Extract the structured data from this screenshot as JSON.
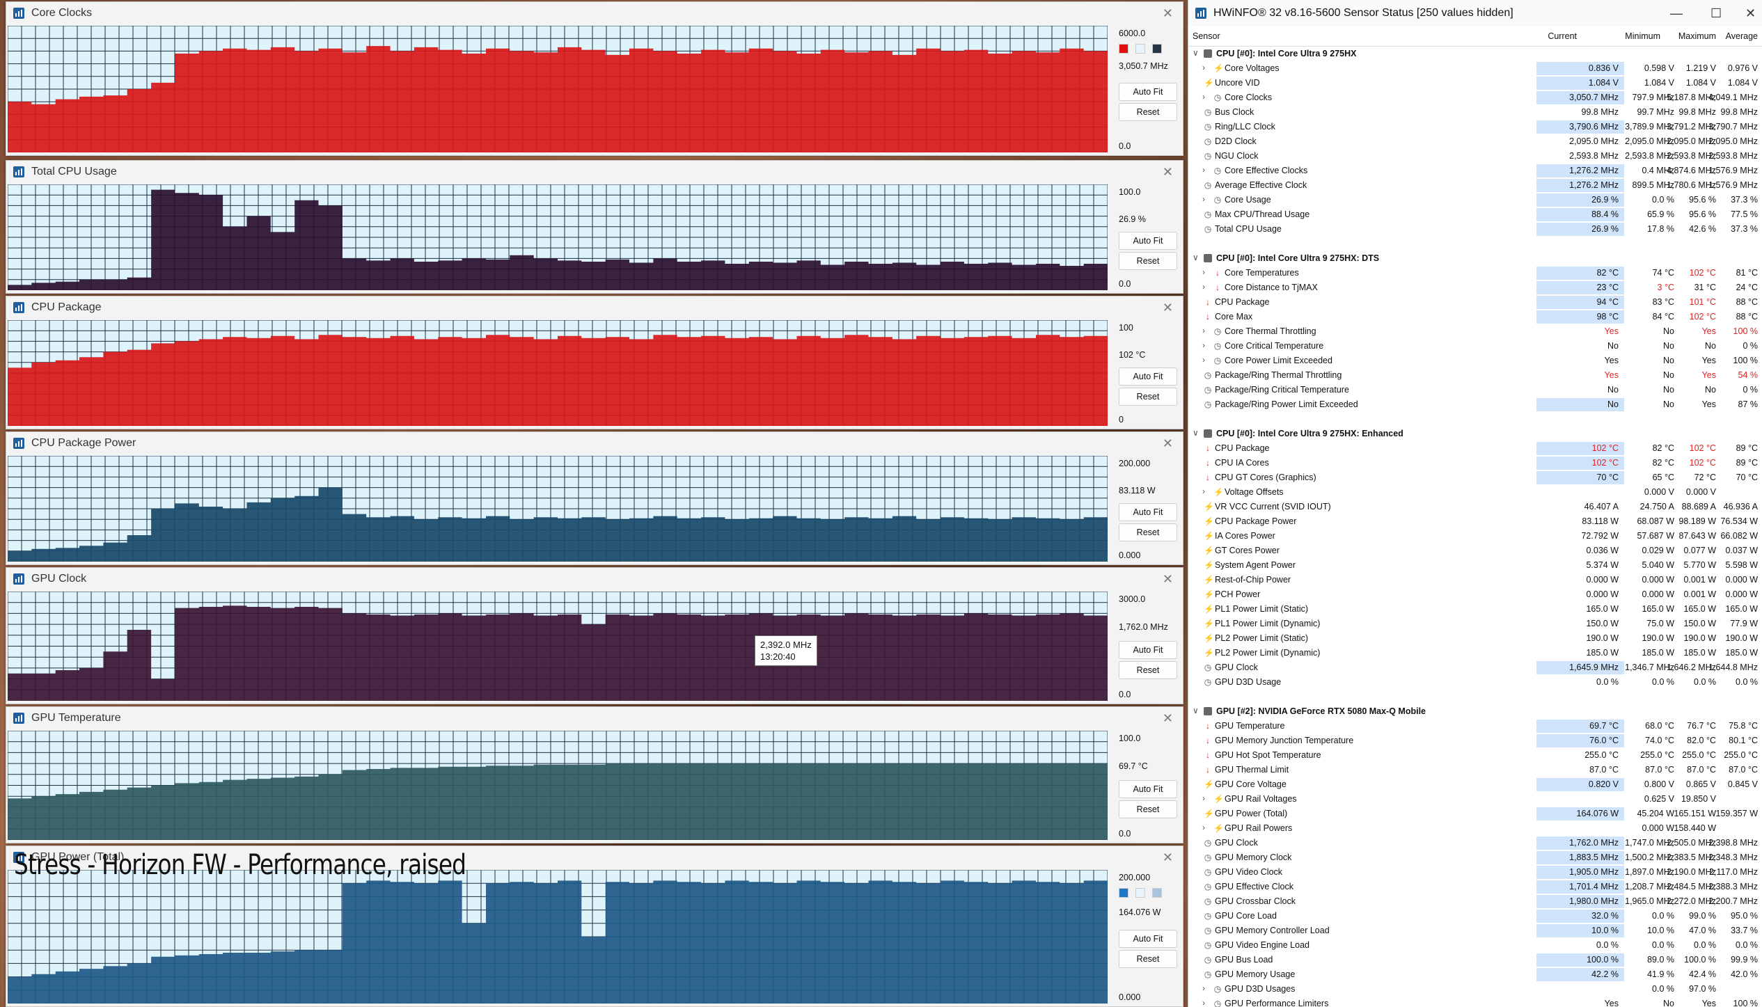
{
  "graphs": [
    {
      "title": "Core Clocks",
      "max": "6000.0",
      "current": "3,050.7 MHz",
      "min": "0.0",
      "auto_fit": "Auto Fit",
      "reset": "Reset",
      "color": "#d81818",
      "swatches": [
        "#e01010",
        "#e8f4fb",
        "#263444"
      ],
      "series": [
        0.4,
        0.38,
        0.42,
        0.44,
        0.45,
        0.5,
        0.55,
        0.78,
        0.8,
        0.82,
        0.81,
        0.83,
        0.8,
        0.82,
        0.79,
        0.84,
        0.8,
        0.83,
        0.81,
        0.78,
        0.82,
        0.8,
        0.79,
        0.83,
        0.81,
        0.77,
        0.82,
        0.8,
        0.78,
        0.81,
        0.79,
        0.82,
        0.8,
        0.78,
        0.81,
        0.79,
        0.8,
        0.77,
        0.82,
        0.8,
        0.81,
        0.78,
        0.8,
        0.79,
        0.82,
        0.8,
        0.78
      ]
    },
    {
      "title": "Total CPU Usage",
      "max": "100.0",
      "current": "26.9 %",
      "min": "0.0",
      "auto_fit": "Auto Fit",
      "reset": "Reset",
      "color": "#2a0f30",
      "series": [
        0.05,
        0.07,
        0.08,
        0.1,
        0.1,
        0.12,
        0.95,
        0.92,
        0.9,
        0.6,
        0.7,
        0.55,
        0.85,
        0.8,
        0.3,
        0.28,
        0.3,
        0.27,
        0.28,
        0.3,
        0.29,
        0.33,
        0.3,
        0.28,
        0.27,
        0.29,
        0.26,
        0.3,
        0.27,
        0.28,
        0.25,
        0.27,
        0.26,
        0.28,
        0.24,
        0.27,
        0.25,
        0.26,
        0.24,
        0.27,
        0.25,
        0.26,
        0.24,
        0.25,
        0.23,
        0.25,
        0.26
      ]
    },
    {
      "title": "CPU Package",
      "max": "100",
      "current": "102 °C",
      "min": "0",
      "auto_fit": "Auto Fit",
      "reset": "Reset",
      "color": "#d81818",
      "series": [
        0.55,
        0.6,
        0.62,
        0.65,
        0.7,
        0.72,
        0.78,
        0.8,
        0.82,
        0.84,
        0.83,
        0.85,
        0.82,
        0.86,
        0.84,
        0.83,
        0.85,
        0.82,
        0.84,
        0.83,
        0.86,
        0.84,
        0.82,
        0.85,
        0.83,
        0.84,
        0.82,
        0.86,
        0.84,
        0.85,
        0.83,
        0.84,
        0.82,
        0.85,
        0.83,
        0.86,
        0.84,
        0.82,
        0.85,
        0.83,
        0.84,
        0.85,
        0.83,
        0.86,
        0.84,
        0.85,
        0.95
      ]
    },
    {
      "title": "CPU Package Power",
      "max": "200.000",
      "current": "83.118 W",
      "min": "0.000",
      "auto_fit": "Auto Fit",
      "reset": "Reset",
      "color": "#184a6a",
      "series": [
        0.1,
        0.12,
        0.13,
        0.15,
        0.18,
        0.25,
        0.5,
        0.55,
        0.52,
        0.5,
        0.56,
        0.6,
        0.62,
        0.7,
        0.45,
        0.42,
        0.43,
        0.4,
        0.42,
        0.41,
        0.43,
        0.4,
        0.42,
        0.41,
        0.42,
        0.4,
        0.41,
        0.43,
        0.41,
        0.42,
        0.4,
        0.41,
        0.43,
        0.41,
        0.4,
        0.42,
        0.41,
        0.43,
        0.4,
        0.42,
        0.41,
        0.4,
        0.42,
        0.41,
        0.4,
        0.42,
        0.43
      ]
    },
    {
      "title": "GPU Clock",
      "max": "3000.0",
      "current": "1,762.0 MHz",
      "min": "0.0",
      "auto_fit": "Auto Fit",
      "reset": "Reset",
      "color": "#3a1634",
      "tooltip": "2,392.0 MHz",
      "tooltip_time": "13:20:40",
      "series": [
        0.25,
        0.25,
        0.28,
        0.3,
        0.45,
        0.65,
        0.2,
        0.85,
        0.86,
        0.87,
        0.86,
        0.85,
        0.86,
        0.85,
        0.8,
        0.79,
        0.78,
        0.79,
        0.8,
        0.78,
        0.79,
        0.8,
        0.78,
        0.79,
        0.7,
        0.79,
        0.78,
        0.8,
        0.79,
        0.78,
        0.79,
        0.8,
        0.78,
        0.79,
        0.78,
        0.8,
        0.79,
        0.78,
        0.79,
        0.78,
        0.8,
        0.79,
        0.78,
        0.79,
        0.8,
        0.78,
        0.6
      ]
    },
    {
      "title": "GPU Temperature",
      "max": "100.0",
      "current": "69.7 °C",
      "min": "0.0",
      "auto_fit": "Auto Fit",
      "reset": "Reset",
      "color": "#2e5a5e",
      "series": [
        0.38,
        0.4,
        0.42,
        0.44,
        0.46,
        0.48,
        0.5,
        0.52,
        0.53,
        0.55,
        0.56,
        0.57,
        0.58,
        0.6,
        0.64,
        0.65,
        0.66,
        0.66,
        0.67,
        0.67,
        0.68,
        0.68,
        0.69,
        0.69,
        0.69,
        0.7,
        0.7,
        0.7,
        0.7,
        0.7,
        0.7,
        0.7,
        0.7,
        0.7,
        0.7,
        0.7,
        0.7,
        0.7,
        0.7,
        0.7,
        0.7,
        0.7,
        0.7,
        0.7,
        0.7,
        0.7,
        0.69
      ]
    },
    {
      "title": "GPU Power (Total)",
      "max": "200.000",
      "current": "164.076 W",
      "min": "0.000",
      "auto_fit": "Auto Fit",
      "reset": "Reset",
      "color": "#1e5a88",
      "swatches": [
        "#1e78c8",
        "#e8f4fb",
        "#a8c4e0"
      ],
      "series": [
        0.2,
        0.22,
        0.24,
        0.26,
        0.28,
        0.3,
        0.35,
        0.36,
        0.37,
        0.38,
        0.38,
        0.39,
        0.4,
        0.4,
        0.9,
        0.92,
        0.91,
        0.9,
        0.92,
        0.6,
        0.9,
        0.91,
        0.9,
        0.92,
        0.5,
        0.91,
        0.9,
        0.92,
        0.91,
        0.9,
        0.92,
        0.91,
        0.9,
        0.92,
        0.91,
        0.9,
        0.92,
        0.91,
        0.9,
        0.92,
        0.91,
        0.9,
        0.92,
        0.91,
        0.9,
        0.92,
        0.8
      ]
    }
  ],
  "caption": "Stress - Horizon FW - Performance, raised",
  "hwinfo": {
    "title": "HWiNFO® 32 v8.16-5600 Sensor Status [250 values hidden]",
    "columns": {
      "sensor": "Sensor",
      "current": "Current",
      "minimum": "Minimum",
      "maximum": "Maximum",
      "average": "Average"
    },
    "rows": [
      {
        "t": "hdr",
        "n": "CPU [#0]: Intel Core Ultra 9 275HX"
      },
      {
        "n": "Core Voltages",
        "i": "bolt",
        "e": 1,
        "c": "0.836 V",
        "mi": "0.598 V",
        "ma": "1.219 V",
        "a": "0.976 V",
        "hl": 1
      },
      {
        "n": "Uncore VID",
        "i": "bolt",
        "c": "1.084 V",
        "mi": "1.084 V",
        "ma": "1.084 V",
        "a": "1.084 V",
        "hl": 1
      },
      {
        "n": "Core Clocks",
        "i": "clock",
        "e": 1,
        "c": "3,050.7 MHz",
        "mi": "797.9 MHz",
        "ma": "5,187.8 MHz",
        "a": "4,049.1 MHz",
        "hl": 1
      },
      {
        "n": "Bus Clock",
        "i": "clock",
        "c": "99.8 MHz",
        "mi": "99.7 MHz",
        "ma": "99.8 MHz",
        "a": "99.8 MHz"
      },
      {
        "n": "Ring/LLC Clock",
        "i": "clock",
        "c": "3,790.6 MHz",
        "mi": "3,789.9 MHz",
        "ma": "3,791.2 MHz",
        "a": "3,790.7 MHz",
        "hl": 1
      },
      {
        "n": "D2D Clock",
        "i": "clock",
        "c": "2,095.0 MHz",
        "mi": "2,095.0 MHz",
        "ma": "2,095.0 MHz",
        "a": "2,095.0 MHz"
      },
      {
        "n": "NGU Clock",
        "i": "clock",
        "c": "2,593.8 MHz",
        "mi": "2,593.8 MHz",
        "ma": "2,593.8 MHz",
        "a": "2,593.8 MHz"
      },
      {
        "n": "Core Effective Clocks",
        "i": "clock",
        "e": 1,
        "c": "1,276.2 MHz",
        "mi": "0.4 MHz",
        "ma": "4,874.6 MHz",
        "a": "1,576.9 MHz",
        "hl": 1
      },
      {
        "n": "Average Effective Clock",
        "i": "clock",
        "c": "1,276.2 MHz",
        "mi": "899.5 MHz",
        "ma": "1,780.6 MHz",
        "a": "1,576.9 MHz",
        "hl": 1
      },
      {
        "n": "Core Usage",
        "i": "clock",
        "e": 1,
        "c": "26.9 %",
        "mi": "0.0 %",
        "ma": "95.6 %",
        "a": "37.3 %",
        "hl": 1
      },
      {
        "n": "Max CPU/Thread Usage",
        "i": "clock",
        "c": "88.4 %",
        "mi": "65.9 %",
        "ma": "95.6 %",
        "a": "77.5 %",
        "hl": 1
      },
      {
        "n": "Total CPU Usage",
        "i": "clock",
        "c": "26.9 %",
        "mi": "17.8 %",
        "ma": "42.6 %",
        "a": "37.3 %",
        "hl": 1
      },
      {
        "t": "blank"
      },
      {
        "t": "hdr",
        "n": "CPU [#0]: Intel Core Ultra 9 275HX: DTS"
      },
      {
        "n": "Core Temperatures",
        "i": "therm",
        "e": 1,
        "c": "82 °C",
        "mi": "74 °C",
        "ma": "102 °C",
        "a": "81 °C",
        "hl": 1,
        "rma": 1
      },
      {
        "n": "Core Distance to TjMAX",
        "i": "therm",
        "e": 1,
        "c": "23 °C",
        "mi": "3 °C",
        "ma": "31 °C",
        "a": "24 °C",
        "hl": 1,
        "rmi": 1
      },
      {
        "n": "CPU Package",
        "i": "therm",
        "c": "94 °C",
        "mi": "83 °C",
        "ma": "101 °C",
        "a": "88 °C",
        "hl": 1,
        "rma": 1
      },
      {
        "n": "Core Max",
        "i": "therm",
        "c": "98 °C",
        "mi": "84 °C",
        "ma": "102 °C",
        "a": "88 °C",
        "hl": 1,
        "rma": 1
      },
      {
        "n": "Core Thermal Throttling",
        "i": "clock",
        "e": 1,
        "c": "Yes",
        "mi": "No",
        "ma": "Yes",
        "a": "100 %",
        "rc": 1,
        "rma": 1,
        "ra": 1
      },
      {
        "n": "Core Critical Temperature",
        "i": "clock",
        "e": 1,
        "c": "No",
        "mi": "No",
        "ma": "No",
        "a": "0 %"
      },
      {
        "n": "Core Power Limit Exceeded",
        "i": "clock",
        "e": 1,
        "c": "Yes",
        "mi": "No",
        "ma": "Yes",
        "a": "100 %"
      },
      {
        "n": "Package/Ring Thermal Throttling",
        "i": "clock",
        "c": "Yes",
        "mi": "No",
        "ma": "Yes",
        "a": "54 %",
        "rc": 1,
        "rma": 1,
        "ra": 1
      },
      {
        "n": "Package/Ring Critical Temperature",
        "i": "clock",
        "c": "No",
        "mi": "No",
        "ma": "No",
        "a": "0 %"
      },
      {
        "n": "Package/Ring Power Limit Exceeded",
        "i": "clock",
        "c": "No",
        "mi": "No",
        "ma": "Yes",
        "a": "87 %",
        "hl": 1
      },
      {
        "t": "blank"
      },
      {
        "t": "hdr",
        "n": "CPU [#0]: Intel Core Ultra 9 275HX: Enhanced"
      },
      {
        "n": "CPU Package",
        "i": "therm",
        "c": "102 °C",
        "mi": "82 °C",
        "ma": "102 °C",
        "a": "89 °C",
        "hl": 1,
        "rc": 1,
        "rma": 1
      },
      {
        "n": "CPU IA Cores",
        "i": "therm",
        "c": "102 °C",
        "mi": "82 °C",
        "ma": "102 °C",
        "a": "89 °C",
        "hl": 1,
        "rc": 1,
        "rma": 1
      },
      {
        "n": "CPU GT Cores (Graphics)",
        "i": "therm",
        "c": "70 °C",
        "mi": "65 °C",
        "ma": "72 °C",
        "a": "70 °C",
        "hl": 1
      },
      {
        "n": "Voltage Offsets",
        "i": "bolt",
        "e": 1,
        "c": "",
        "mi": "0.000 V",
        "ma": "0.000 V",
        "a": ""
      },
      {
        "n": "VR VCC Current (SVID IOUT)",
        "i": "bolt",
        "c": "46.407 A",
        "mi": "24.750 A",
        "ma": "88.689 A",
        "a": "46.936 A"
      },
      {
        "n": "CPU Package Power",
        "i": "bolt",
        "c": "83.118 W",
        "mi": "68.087 W",
        "ma": "98.189 W",
        "a": "76.534 W"
      },
      {
        "n": "IA Cores Power",
        "i": "bolt",
        "c": "72.792 W",
        "mi": "57.687 W",
        "ma": "87.643 W",
        "a": "66.082 W"
      },
      {
        "n": "GT Cores Power",
        "i": "bolt",
        "c": "0.036 W",
        "mi": "0.029 W",
        "ma": "0.077 W",
        "a": "0.037 W"
      },
      {
        "n": "System Agent Power",
        "i": "bolt",
        "c": "5.374 W",
        "mi": "5.040 W",
        "ma": "5.770 W",
        "a": "5.598 W"
      },
      {
        "n": "Rest-of-Chip Power",
        "i": "bolt",
        "c": "0.000 W",
        "mi": "0.000 W",
        "ma": "0.001 W",
        "a": "0.000 W"
      },
      {
        "n": "PCH Power",
        "i": "bolt",
        "c": "0.000 W",
        "mi": "0.000 W",
        "ma": "0.001 W",
        "a": "0.000 W"
      },
      {
        "n": "PL1 Power Limit (Static)",
        "i": "bolt",
        "c": "165.0 W",
        "mi": "165.0 W",
        "ma": "165.0 W",
        "a": "165.0 W"
      },
      {
        "n": "PL1 Power Limit (Dynamic)",
        "i": "bolt",
        "c": "150.0 W",
        "mi": "75.0 W",
        "ma": "150.0 W",
        "a": "77.9 W"
      },
      {
        "n": "PL2 Power Limit (Static)",
        "i": "bolt",
        "c": "190.0 W",
        "mi": "190.0 W",
        "ma": "190.0 W",
        "a": "190.0 W"
      },
      {
        "n": "PL2 Power Limit (Dynamic)",
        "i": "bolt",
        "c": "185.0 W",
        "mi": "185.0 W",
        "ma": "185.0 W",
        "a": "185.0 W"
      },
      {
        "n": "GPU Clock",
        "i": "clock",
        "c": "1,645.9 MHz",
        "mi": "1,346.7 MHz",
        "ma": "1,646.2 MHz",
        "a": "1,644.8 MHz",
        "hl": 1
      },
      {
        "n": "GPU D3D Usage",
        "i": "clock",
        "c": "0.0 %",
        "mi": "0.0 %",
        "ma": "0.0 %",
        "a": "0.0 %"
      },
      {
        "t": "blank"
      },
      {
        "t": "hdr",
        "n": "GPU [#2]: NVIDIA GeForce RTX 5080 Max-Q Mobile"
      },
      {
        "n": "GPU Temperature",
        "i": "therm",
        "c": "69.7 °C",
        "mi": "68.0 °C",
        "ma": "76.7 °C",
        "a": "75.8 °C",
        "hl": 1
      },
      {
        "n": "GPU Memory Junction Temperature",
        "i": "therm",
        "c": "76.0 °C",
        "mi": "74.0 °C",
        "ma": "82.0 °C",
        "a": "80.1 °C",
        "hl": 1
      },
      {
        "n": "GPU Hot Spot Temperature",
        "i": "therm",
        "c": "255.0 °C",
        "mi": "255.0 °C",
        "ma": "255.0 °C",
        "a": "255.0 °C"
      },
      {
        "n": "GPU Thermal Limit",
        "i": "therm",
        "c": "87.0 °C",
        "mi": "87.0 °C",
        "ma": "87.0 °C",
        "a": "87.0 °C"
      },
      {
        "n": "GPU Core Voltage",
        "i": "bolt",
        "c": "0.820 V",
        "mi": "0.800 V",
        "ma": "0.865 V",
        "a": "0.845 V",
        "hl": 1
      },
      {
        "n": "GPU Rail Voltages",
        "i": "bolt",
        "e": 1,
        "c": "",
        "mi": "0.625 V",
        "ma": "19.850 V",
        "a": ""
      },
      {
        "n": "GPU Power (Total)",
        "i": "bolt",
        "c": "164.076 W",
        "mi": "45.204 W",
        "ma": "165.151 W",
        "a": "159.357 W",
        "hl": 1
      },
      {
        "n": "GPU Rail Powers",
        "i": "bolt",
        "e": 1,
        "c": "",
        "mi": "0.000 W",
        "ma": "158.440 W",
        "a": ""
      },
      {
        "n": "GPU Clock",
        "i": "clock",
        "c": "1,762.0 MHz",
        "mi": "1,747.0 MHz",
        "ma": "2,505.0 MHz",
        "a": "2,398.8 MHz",
        "hl": 1
      },
      {
        "n": "GPU Memory Clock",
        "i": "clock",
        "c": "1,883.5 MHz",
        "mi": "1,500.2 MHz",
        "ma": "2,383.5 MHz",
        "a": "2,348.3 MHz",
        "hl": 1
      },
      {
        "n": "GPU Video Clock",
        "i": "clock",
        "c": "1,905.0 MHz",
        "mi": "1,897.0 MHz",
        "ma": "2,190.0 MHz",
        "a": "2,117.0 MHz",
        "hl": 1
      },
      {
        "n": "GPU Effective Clock",
        "i": "clock",
        "c": "1,701.4 MHz",
        "mi": "1,208.7 MHz",
        "ma": "2,484.5 MHz",
        "a": "2,388.3 MHz",
        "hl": 1
      },
      {
        "n": "GPU Crossbar Clock",
        "i": "clock",
        "c": "1,980.0 MHz",
        "mi": "1,965.0 MHz",
        "ma": "2,272.0 MHz",
        "a": "2,200.7 MHz",
        "hl": 1
      },
      {
        "n": "GPU Core Load",
        "i": "clock",
        "c": "32.0 %",
        "mi": "0.0 %",
        "ma": "99.0 %",
        "a": "95.0 %",
        "hl": 1
      },
      {
        "n": "GPU Memory Controller Load",
        "i": "clock",
        "c": "10.0 %",
        "mi": "10.0 %",
        "ma": "47.0 %",
        "a": "33.7 %",
        "hl": 1
      },
      {
        "n": "GPU Video Engine Load",
        "i": "clock",
        "c": "0.0 %",
        "mi": "0.0 %",
        "ma": "0.0 %",
        "a": "0.0 %"
      },
      {
        "n": "GPU Bus Load",
        "i": "clock",
        "c": "100.0 %",
        "mi": "89.0 %",
        "ma": "100.0 %",
        "a": "99.9 %",
        "hl": 1
      },
      {
        "n": "GPU Memory Usage",
        "i": "clock",
        "c": "42.2 %",
        "mi": "41.9 %",
        "ma": "42.4 %",
        "a": "42.0 %",
        "hl": 1
      },
      {
        "n": "GPU D3D Usages",
        "i": "clock",
        "e": 1,
        "c": "",
        "mi": "0.0 %",
        "ma": "97.0 %",
        "a": ""
      },
      {
        "n": "GPU Performance Limiters",
        "i": "clock",
        "e": 1,
        "c": "Yes",
        "mi": "No",
        "ma": "Yes",
        "a": "100 %"
      }
    ]
  }
}
